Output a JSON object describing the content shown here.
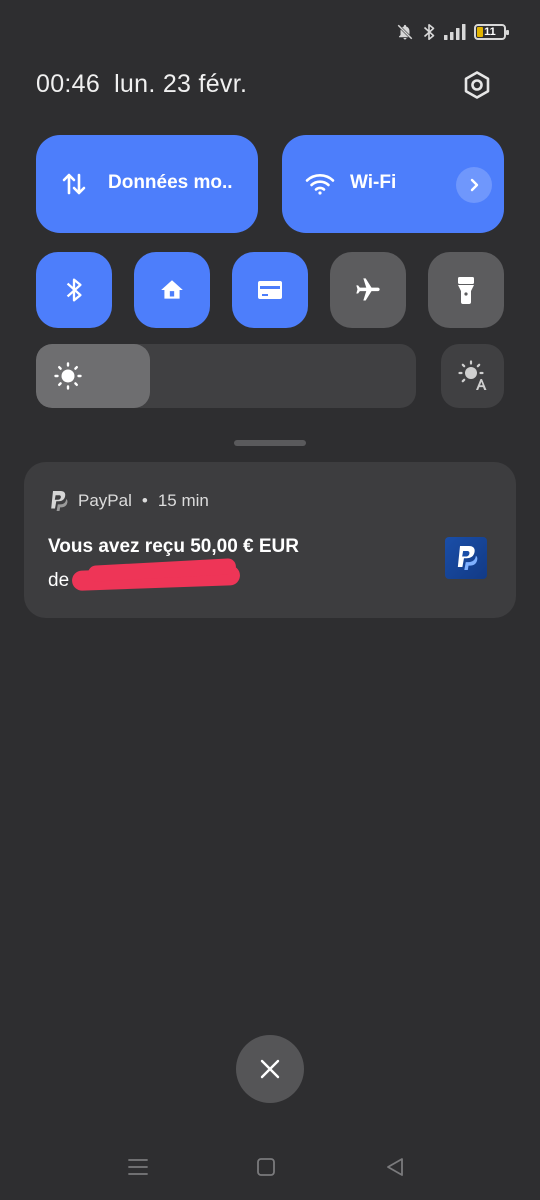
{
  "status_bar": {
    "battery_level": "11",
    "icons": [
      "mute-icon",
      "bluetooth-icon",
      "signal-icon",
      "battery-icon"
    ]
  },
  "header": {
    "time": "00:46",
    "date": "lun. 23 févr."
  },
  "quick_tiles": {
    "mobile_data_label": "Données mo..",
    "wifi_label": "Wi-Fi",
    "small": [
      {
        "icon": "bluetooth-icon",
        "state": "on"
      },
      {
        "icon": "home-icon",
        "state": "on"
      },
      {
        "icon": "card-icon",
        "state": "on"
      },
      {
        "icon": "airplane-icon",
        "state": "off"
      },
      {
        "icon": "flashlight-icon",
        "state": "off"
      }
    ],
    "accent_color": "#4d7efb"
  },
  "brightness": {
    "level": 0.3
  },
  "notification": {
    "app": "PayPal",
    "separator": "•",
    "age": "15 min",
    "title": "Vous avez reçu 50,00 € EUR",
    "body_prefix": "de"
  }
}
